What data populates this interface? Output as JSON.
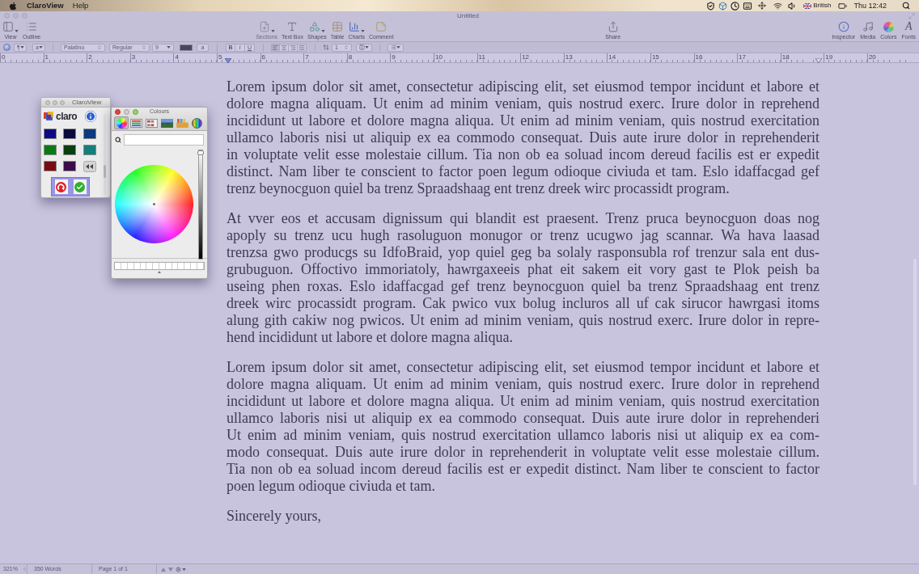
{
  "menu_bar": {
    "app_name": "ClaroView",
    "menus": [
      "Help"
    ],
    "input_source": "British",
    "clock": "Thu 12:42"
  },
  "window": {
    "title": "Untitled"
  },
  "toolbar": {
    "view_items": [
      {
        "kind": "view",
        "label": "View",
        "menu": true,
        "disabled": false
      },
      {
        "kind": "outline",
        "label": "Outline",
        "menu": false,
        "disabled": false
      }
    ],
    "insert_items": [
      {
        "kind": "sections",
        "label": "Sections",
        "menu": true,
        "disabled": true
      },
      {
        "kind": "text_box",
        "label": "Text Box",
        "menu": false,
        "disabled": false
      },
      {
        "kind": "shapes",
        "label": "Shapes",
        "menu": true,
        "disabled": false
      },
      {
        "kind": "table",
        "label": "Table",
        "menu": false,
        "disabled": false
      },
      {
        "kind": "charts",
        "label": "Charts",
        "menu": true,
        "disabled": false
      },
      {
        "kind": "comment",
        "label": "Comment",
        "menu": false,
        "disabled": false
      }
    ],
    "share": {
      "kind": "share",
      "label": "Share",
      "menu": false,
      "disabled": false
    },
    "panel_items": [
      {
        "kind": "inspector",
        "label": "Inspector",
        "menu": false,
        "disabled": false
      },
      {
        "kind": "media",
        "label": "Media",
        "menu": false,
        "disabled": false
      },
      {
        "kind": "colors",
        "label": "Colors",
        "menu": false,
        "disabled": false
      },
      {
        "kind": "fonts",
        "label": "Fonts",
        "glyph": "A",
        "menu": false,
        "disabled": false
      }
    ]
  },
  "format_bar": {
    "paragraph_style": "¶",
    "character_style": "a",
    "font_family": "Palatino",
    "typeface": "Regular",
    "font_size": "9",
    "highlight_sample": "a",
    "bold": "B",
    "italic": "I",
    "underline": "U",
    "line_spacing": "1"
  },
  "ruler": {
    "numbers": [
      "0",
      "1",
      "2",
      "3",
      "4",
      "5",
      "6",
      "7",
      "8",
      "9",
      "10",
      "11",
      "12",
      "13",
      "14",
      "15",
      "16",
      "17",
      "18",
      "19",
      "20"
    ]
  },
  "document": {
    "paragraphs": [
      {
        "lines": [
          "Lorem ipsum dolor sit amet, consectetur adipiscing elit, set eiusmod tempor incidunt et labore et",
          "dolore magna aliquam. Ut enim ad minim veniam, quis nostrud exerc. Irure dolor in reprehend",
          "incididunt ut labore et dolore magna aliqua. Ut enim ad minim veniam, quis nostrud exercitation",
          "ullamco laboris nisi ut aliquip ex ea commodo consequat. Duis aute irure dolor in reprehenderit",
          "in voluptate velit esse molestaie cillum. Tia non ob ea soluad incom dereud facilis est er expedit",
          "distinct. Nam liber te conscient to factor poen legum odioque civiuda et tam. Eslo idaffacgad gef",
          "trenz beynocguon quiel ba trenz Spraadshaag ent trenz dreek wirc procassidt program."
        ]
      },
      {
        "lines": [
          "At vver eos et accusam dignissum qui blandit est praesent. Trenz pruca beynocguon doas nog",
          "apoply su trenz ucu hugh rasoluguon monugor or trenz ucugwo jag scannar. Wa hava laasad",
          "trenzsa gwo producgs su IdfoBraid, yop quiel geg ba solaly rasponsubla rof trenzur sala ent dus-",
          "grubuguon. Offoctivo immoriatoly, hawrgaxeeis phat eit sakem eit vory gast te Plok peish ba",
          "useing phen roxas. Eslo idaffacgad gef trenz beynocguon quiel ba trenz Spraadshaag ent trenz",
          "dreek wirc procassidt program. Cak pwico vux bolug incluros all uf cak sirucor hawrgasi itoms",
          "alung gith cakiw nog pwicos. Ut enim ad minim veniam, quis nostrud exerc. Irure dolor in repre-",
          "hend incididunt ut labore et dolore magna aliqua."
        ]
      },
      {
        "lines": [
          "Lorem ipsum dolor sit amet, consectetur adipiscing elit, set eiusmod tempor incidunt et labore et",
          "dolore magna aliquam. Ut enim ad minim veniam, quis nostrud exerc. Irure dolor in reprehend",
          "incididunt ut labore et dolore magna aliqua. Ut enim ad minim veniam, quis nostrud exercitation",
          "ullamco laboris nisi ut aliquip ex ea commodo consequat. Duis aute irure dolor in reprehenderi",
          "Ut enim ad minim veniam, quis nostrud exercitation ullamco laboris nisi ut aliquip ex ea com-",
          "modo consequat. Duis aute irure dolor in reprehenderit in voluptate velit esse molestaie cillum.",
          "Tia non ob ea soluad incom dereud facilis est er expedit distinct. Nam liber te conscient to factor",
          "poen legum odioque civiuda et tam."
        ]
      },
      {
        "lines": [
          "Sincerely yours,"
        ]
      }
    ]
  },
  "status_bar": {
    "zoom": "321%",
    "word_count": "350 Words",
    "page": "Page 1 of 1"
  },
  "claroview_panel": {
    "title": "ClaroView",
    "logo_text": "claro",
    "swatches": [
      {
        "color": "#0b0b86"
      },
      {
        "color": "#0a0a3e"
      },
      {
        "color": "#0b3a80"
      },
      {
        "color": "#0a7a12"
      },
      {
        "color": "#0a3f0e"
      },
      {
        "color": "#14807c"
      },
      {
        "color": "#7a0a12"
      },
      {
        "color": "#3a0d4a"
      }
    ]
  },
  "colours_panel": {
    "title": "Colours",
    "modes": [
      {
        "kind": "wheel",
        "selected": true
      },
      {
        "kind": "sliders",
        "selected": false
      },
      {
        "kind": "palettes",
        "selected": false
      },
      {
        "kind": "image",
        "selected": false
      },
      {
        "kind": "pencils",
        "selected": false
      },
      {
        "kind": "spectrum",
        "selected": false
      }
    ],
    "brightness": {
      "level": 1
    }
  }
}
